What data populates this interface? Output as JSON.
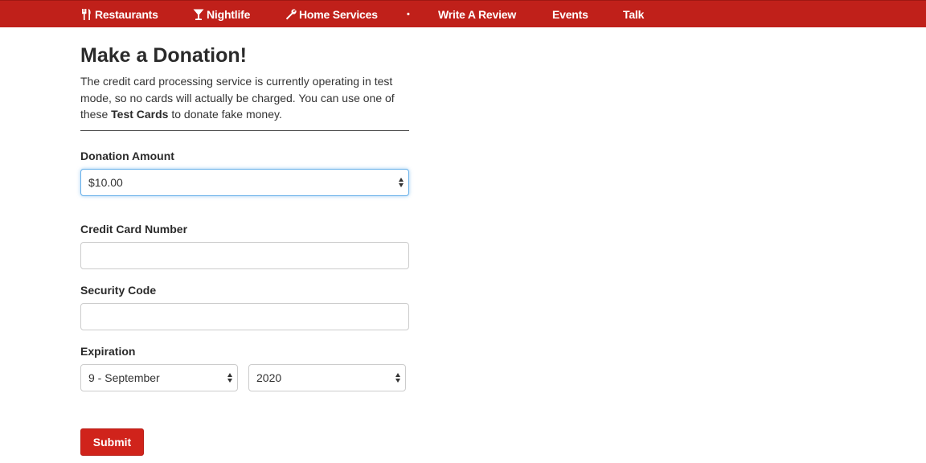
{
  "nav": {
    "items": [
      {
        "label": "Restaurants",
        "icon": "fork-knife-icon"
      },
      {
        "label": "Nightlife",
        "icon": "cocktail-icon"
      },
      {
        "label": "Home Services",
        "icon": "wrench-icon"
      },
      {
        "label": "Write A Review"
      },
      {
        "label": "Events"
      },
      {
        "label": "Talk"
      }
    ],
    "separator": "•"
  },
  "page": {
    "title": "Make a Donation!",
    "intro_before": "The credit card processing service is currently operating in test mode, so no cards will actually be charged. You can use one of these ",
    "intro_link": "Test Cards",
    "intro_after": " to donate fake money."
  },
  "form": {
    "donation_label": "Donation Amount",
    "donation_value": "$10.00",
    "card_label": "Credit Card Number",
    "card_value": "",
    "security_label": "Security Code",
    "security_value": "",
    "expiration_label": "Expiration",
    "exp_month_value": "9 - September",
    "exp_year_value": "2020",
    "submit_label": "Submit"
  },
  "colors": {
    "nav_background": "#c0201a",
    "submit_background": "#d0231b",
    "focus_border": "#66afe9"
  }
}
